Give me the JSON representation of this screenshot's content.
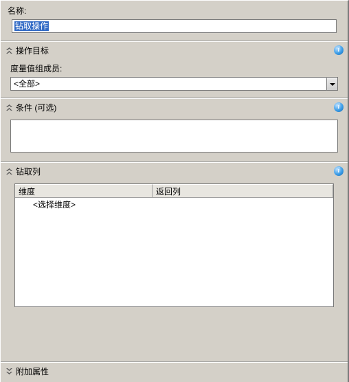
{
  "name": {
    "label": "名称:",
    "value": "钻取操作"
  },
  "target": {
    "header": "操作目标",
    "memberLabel": "度量值组成员:",
    "memberValue": "<全部>"
  },
  "condition": {
    "header": "条件 (可选)",
    "value": ""
  },
  "drill": {
    "header": "钻取列",
    "columns": {
      "dim": "维度",
      "ret": "返回列"
    },
    "placeholderRow": "<选择维度>"
  },
  "extra": {
    "header": "附加属性"
  },
  "icons": {
    "collapse": "«",
    "expand": "»",
    "info": "i"
  }
}
